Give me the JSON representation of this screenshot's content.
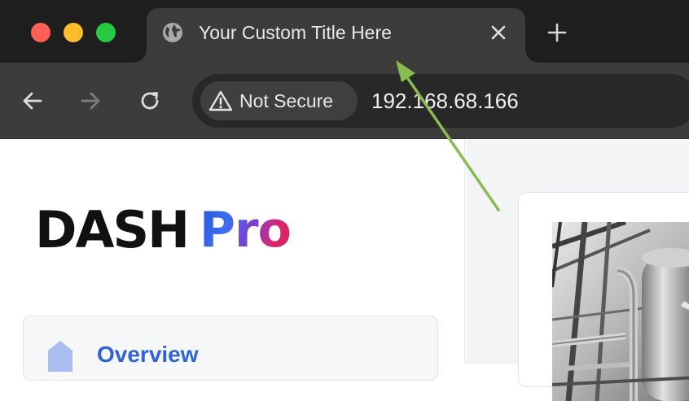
{
  "window": {
    "controls": [
      "close",
      "minimize",
      "zoom"
    ]
  },
  "tab": {
    "icon": "globe-icon",
    "title": "Your Custom Title Here",
    "close_icon": "close-icon"
  },
  "new_tab_icon": "plus-icon",
  "toolbar": {
    "back_icon": "arrow-left-icon",
    "forward_icon": "arrow-right-icon",
    "reload_icon": "reload-icon",
    "security_icon": "warning-triangle-icon",
    "security_label": "Not Secure",
    "url": "192.168.68.166"
  },
  "sidebar": {
    "logo": {
      "primary": "DASH",
      "secondary": "Pro"
    },
    "nav": {
      "overview_label": "Overview",
      "overview_icon": "home-icon"
    }
  },
  "main": {
    "image": "industrial-plant-photo"
  },
  "colors": {
    "tab_bar": "#1e1e1f",
    "toolbar": "#3c3c3c",
    "omnibox": "#282828",
    "traffic_red": "#fe5f57",
    "traffic_yellow": "#febc2e",
    "traffic_green": "#28c840",
    "nav_accent": "#2f63d6",
    "annotation_arrow": "#86bd4e"
  }
}
